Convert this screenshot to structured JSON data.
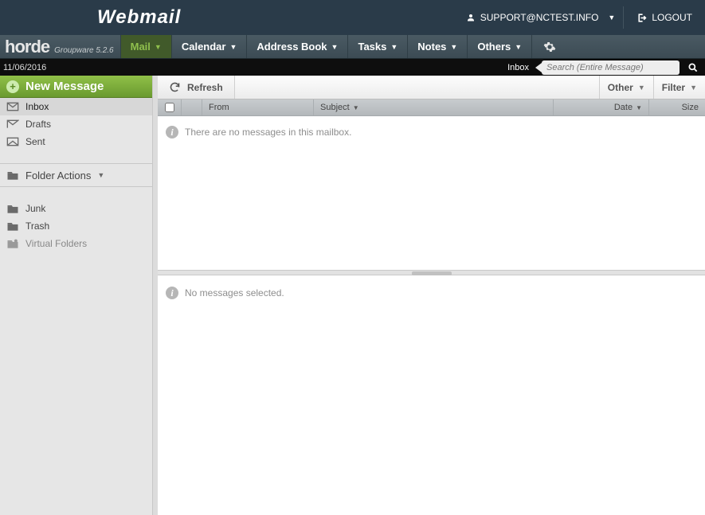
{
  "topbar": {
    "brand": "Webmail",
    "user": "SUPPORT@NCTEST.INFO",
    "logout": "LOGOUT"
  },
  "navbar": {
    "logo": "horde",
    "sub": "Groupware 5.2.6",
    "items": [
      "Mail",
      "Calendar",
      "Address Book",
      "Tasks",
      "Notes",
      "Others"
    ],
    "active_index": 0
  },
  "subbar": {
    "date": "11/06/2016",
    "context_label": "Inbox",
    "search_placeholder": "Search (Entire Message)"
  },
  "sidebar": {
    "compose": "New Message",
    "mailboxes": [
      {
        "label": "Inbox",
        "selected": true
      },
      {
        "label": "Drafts",
        "selected": false
      },
      {
        "label": "Sent",
        "selected": false
      }
    ],
    "folder_actions": "Folder Actions",
    "system": [
      {
        "label": "Junk"
      },
      {
        "label": "Trash"
      },
      {
        "label": "Virtual Folders",
        "dim": true
      }
    ]
  },
  "toolbar": {
    "refresh": "Refresh",
    "other": "Other",
    "filter": "Filter"
  },
  "columns": {
    "from": "From",
    "subject": "Subject",
    "date": "Date",
    "size": "Size"
  },
  "messages": {
    "empty_list": "There are no messages in this mailbox.",
    "none_selected": "No messages selected."
  }
}
